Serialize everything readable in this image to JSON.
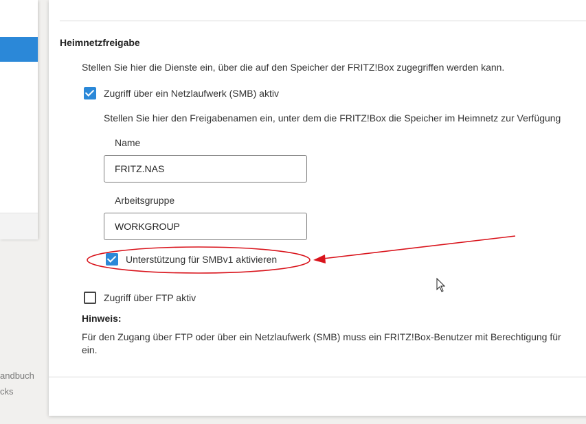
{
  "sidebar": {
    "links": [
      {
        "label": "andbuch"
      },
      {
        "label": "cks"
      }
    ]
  },
  "section": {
    "title": "Heimnetzfreigabe",
    "intro": "Stellen Sie hier die Dienste ein, über die auf den Speicher der FRITZ!Box zugegriffen werden kann."
  },
  "smb": {
    "label": "Zugriff über ein Netzlaufwerk (SMB) aktiv",
    "checked": true,
    "description": "Stellen Sie hier den Freigabenamen ein, unter dem die FRITZ!Box die Speicher im Heimnetz zur Verfügung",
    "name_label": "Name",
    "name_value": "FRITZ.NAS",
    "workgroup_label": "Arbeitsgruppe",
    "workgroup_value": "WORKGROUP",
    "smbv1_label": "Unterstützung für SMBv1 aktivieren",
    "smbv1_checked": true
  },
  "ftp": {
    "label": "Zugriff über FTP aktiv",
    "checked": false
  },
  "hint": {
    "title": "Hinweis:",
    "line1": "Für den Zugang über FTP oder über ein Netzlaufwerk (SMB) muss ein FRITZ!Box-Benutzer mit Berechtigung für",
    "line2": "ein."
  },
  "colors": {
    "accent": "#2b88d8",
    "annotation": "#d9141c"
  },
  "icons": {
    "checkbox_checked": "checkmark-icon",
    "cursor": "mouse-pointer-icon"
  }
}
